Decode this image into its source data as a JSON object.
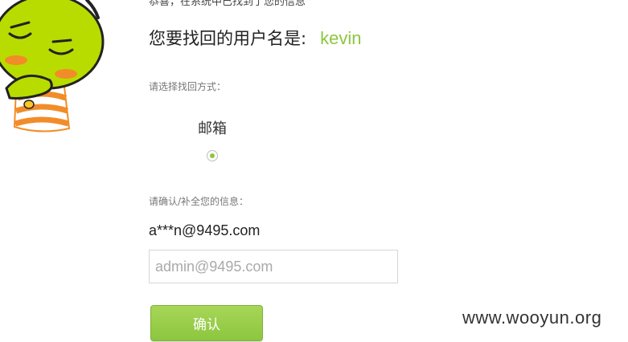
{
  "header": {
    "top_text": "恭喜，在系统中已找到了您的信息",
    "username_label": "您要找回的用户名是:",
    "username_value": "kevin"
  },
  "method": {
    "prompt": "请选择找回方式：",
    "option_label": "邮箱",
    "selected": true
  },
  "confirm": {
    "prompt": "请确认/补全您的信息：",
    "masked_email": "a***n@9495.com",
    "input_value": "",
    "input_placeholder": "admin@9495.com",
    "button_label": "确认"
  },
  "watermark": "www.wooyun.org",
  "colors": {
    "accent": "#8cc63f",
    "button_top": "#a7d657",
    "button_bottom": "#8cc63f"
  }
}
